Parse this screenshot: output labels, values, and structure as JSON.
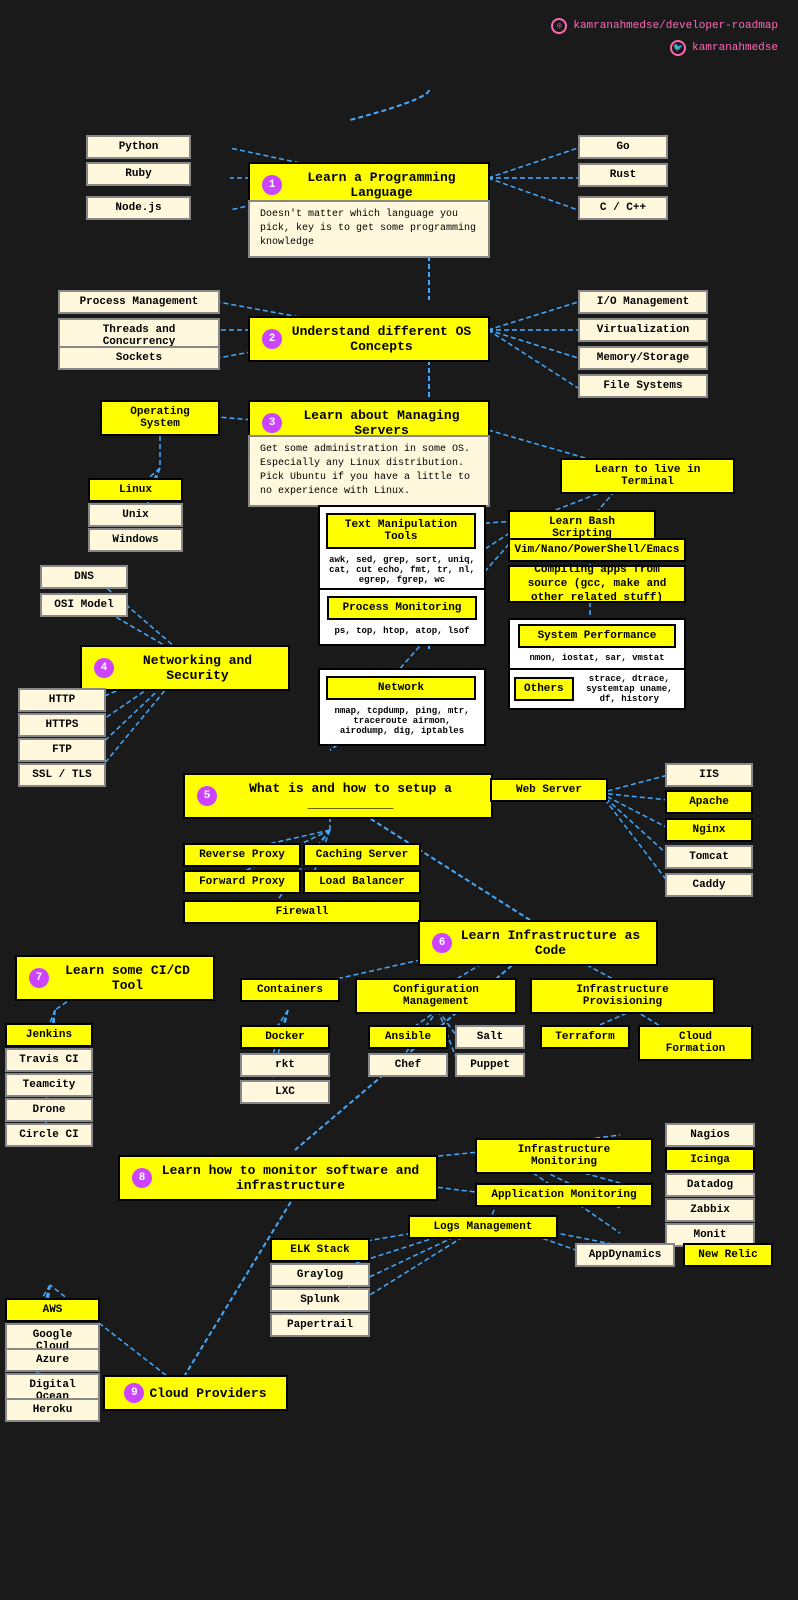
{
  "header": {
    "github_text": "kamranahmedse/developer-roadmap",
    "twitter_text": "kamranahmedse"
  },
  "nodes": {
    "step1": "Learn a Programming Language",
    "step1_desc": "Doesn't matter which language you pick, key is to get some programming knowledge",
    "step2": "Understand different OS Concepts",
    "step3": "Learn about Managing Servers",
    "step3_desc": "Get some administration in some OS. Especially any Linux distribution. Pick Ubuntu if you have a little to no experience with Linux.",
    "step4": "Networking and Security",
    "step5": "What is and how to setup a ___________",
    "step6": "Learn Infrastructure as Code",
    "step7": "Learn some CI/CD Tool",
    "step8": "Learn how to monitor software and infrastructure",
    "step9": "Cloud Providers",
    "python": "Python",
    "ruby": "Ruby",
    "nodejs": "Node.js",
    "go": "Go",
    "rust": "Rust",
    "cpp": "C / C++",
    "process_mgmt": "Process Management",
    "threads": "Threads and Concurrency",
    "sockets": "Sockets",
    "io_mgmt": "I/O Management",
    "virtualization": "Virtualization",
    "memory": "Memory/Storage",
    "file_systems": "File Systems",
    "os": "Operating System",
    "linux": "Linux",
    "unix": "Unix",
    "windows": "Windows",
    "terminal": "Learn to live in Terminal",
    "text_manip": "Text Manipulation Tools",
    "text_manip_desc": "awk, sed, grep, sort, uniq, cat, cut echo, fmt, tr, nl, egrep, fgrep, wc",
    "bash": "Learn Bash Scripting",
    "vim": "Vim/Nano/PowerShell/Emacs",
    "compiling": "Compiling apps from source (gcc, make and other related stuff)",
    "proc_monitor": "Process Monitoring",
    "proc_monitor_desc": "ps, top, htop, atop, lsof",
    "sys_perf": "System Performance",
    "sys_perf_desc": "nmon, iostat, sar, vmstat",
    "network_box": "Network",
    "network_desc": "nmap, tcpdump, ping, mtr, traceroute airmon, airodump, dig, iptables",
    "others": "Others",
    "others_desc": "strace, dtrace, systemtap uname, df, history",
    "dns": "DNS",
    "osi": "OSI Model",
    "http": "HTTP",
    "https": "HTTPS",
    "ftp": "FTP",
    "ssl": "SSL / TLS",
    "reverse_proxy": "Reverse Proxy",
    "forward_proxy": "Forward Proxy",
    "caching": "Caching Server",
    "load_balancer": "Load Balancer",
    "firewall": "Firewall",
    "web_server": "Web Server",
    "iis": "IIS",
    "apache": "Apache",
    "nginx": "Nginx",
    "tomcat": "Tomcat",
    "caddy": "Caddy",
    "containers": "Containers",
    "config_mgmt": "Configuration Management",
    "infra_prov": "Infrastructure Provisioning",
    "docker": "Docker",
    "rkt": "rkt",
    "lxc": "LXC",
    "ansible": "Ansible",
    "salt": "Salt",
    "chef": "Chef",
    "puppet": "Puppet",
    "terraform": "Terraform",
    "cloudformation": "Cloud Formation",
    "jenkins": "Jenkins",
    "travis": "Travis CI",
    "teamcity": "Teamcity",
    "drone": "Drone",
    "circle_ci": "Circle CI",
    "infra_monitor": "Infrastructure Monitoring",
    "app_monitor": "Application Monitoring",
    "nagios": "Nagios",
    "icinga": "Icinga",
    "datadog": "Datadog",
    "zabbix": "Zabbix",
    "monit": "Monit",
    "logs_mgmt": "Logs Management",
    "elk": "ELK Stack",
    "graylog": "Graylog",
    "splunk": "Splunk",
    "papertrail": "Papertrail",
    "appdynamics": "AppDynamics",
    "new_relic": "New Relic",
    "aws": "AWS",
    "google_cloud": "Google Cloud",
    "azure": "Azure",
    "digital_ocean": "Digital Ocean",
    "heroku": "Heroku"
  }
}
